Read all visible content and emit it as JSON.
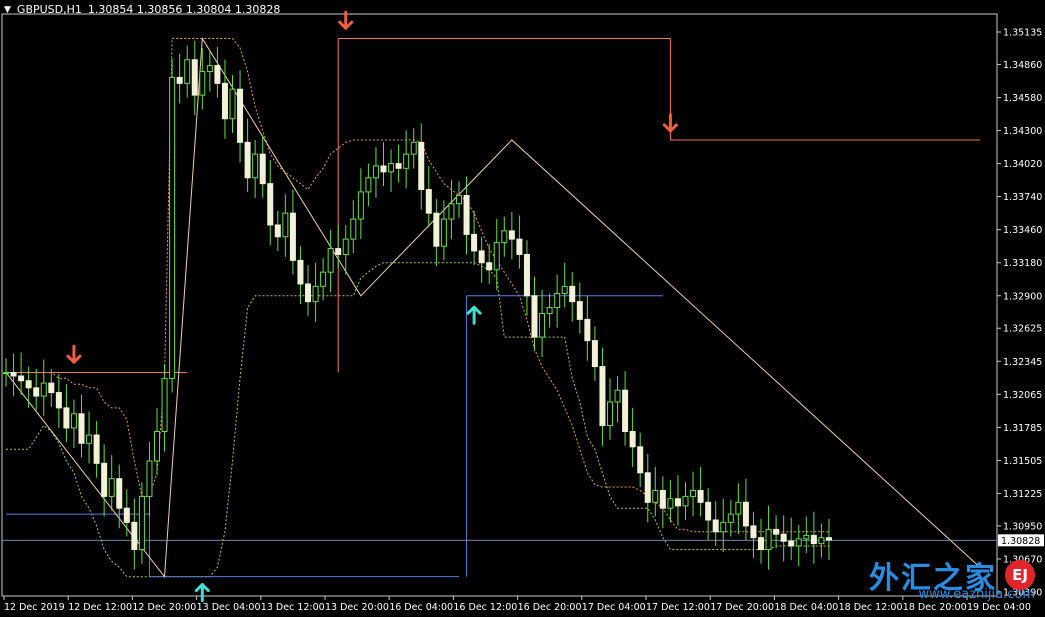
{
  "header": {
    "symbol": "GBPUSD,H1",
    "quote": "1.30854 1.30856 1.30804 1.30828"
  },
  "watermark": {
    "text": "外汇之家",
    "seal": "EJ",
    "url": "www.eazhijia.com"
  },
  "chart_data": {
    "type": "candlestick",
    "price_min": 1.3039,
    "price_max": 1.3518,
    "y_ticks": [
      "1.35135",
      "1.34860",
      "1.34580",
      "1.34300",
      "1.34020",
      "1.33740",
      "1.33460",
      "1.33180",
      "1.32900",
      "1.32625",
      "1.32345",
      "1.32065",
      "1.31785",
      "1.31505",
      "1.31225",
      "1.30950",
      "1.30670",
      "1.30390"
    ],
    "current_price": "1.30828",
    "x_labels": [
      "12 Dec 2019",
      "12 Dec 12:00",
      "12 Dec 20:00",
      "13 Dec 04:00",
      "13 Dec 12:00",
      "13 Dec 20:00",
      "16 Dec 04:00",
      "16 Dec 12:00",
      "16 Dec 20:00",
      "17 Dec 04:00",
      "17 Dec 12:00",
      "17 Dec 20:00",
      "18 Dec 04:00",
      "18 Dec 12:00",
      "18 Dec 20:00",
      "19 Dec 04:00"
    ],
    "closes": [
      1.3225,
      1.3222,
      1.3218,
      1.3212,
      1.3205,
      1.3216,
      1.3208,
      1.3195,
      1.3178,
      1.319,
      1.3165,
      1.3172,
      1.3148,
      1.312,
      1.3135,
      1.311,
      1.3098,
      1.3075,
      1.312,
      1.315,
      1.3175,
      1.322,
      1.3475,
      1.347,
      1.349,
      1.346,
      1.348,
      1.3485,
      1.347,
      1.344,
      1.3465,
      1.342,
      1.339,
      1.341,
      1.3385,
      1.335,
      1.334,
      1.336,
      1.332,
      1.33,
      1.3285,
      1.3298,
      1.331,
      1.333,
      1.3325,
      1.3338,
      1.3355,
      1.3378,
      1.339,
      1.34,
      1.3395,
      1.3402,
      1.3398,
      1.341,
      1.342,
      1.338,
      1.336,
      1.3332,
      1.3355,
      1.3368,
      1.3375,
      1.3342,
      1.3328,
      1.3318,
      1.3312,
      1.3335,
      1.3345,
      1.3338,
      1.3325,
      1.329,
      1.3255,
      1.3275,
      1.328,
      1.3292,
      1.3298,
      1.3285,
      1.327,
      1.3252,
      1.323,
      1.318,
      1.32,
      1.321,
      1.3175,
      1.3162,
      1.314,
      1.3115,
      1.3125,
      1.311,
      1.3118,
      1.3112,
      1.312,
      1.3125,
      1.3115,
      1.31,
      1.309,
      1.3098,
      1.3105,
      1.3115,
      1.3095,
      1.3085,
      1.3075,
      1.3092,
      1.3088,
      1.3082,
      1.3078,
      1.3084,
      1.3087,
      1.308,
      1.3085,
      1.3083
    ],
    "overlays": {
      "upper_channel": [
        1.3225,
        1.3225,
        1.3225,
        1.3225,
        1.3225,
        1.3225,
        1.3225,
        1.322,
        1.322,
        1.3215,
        1.3215,
        1.3212,
        1.3212,
        1.32,
        1.3195,
        1.3195,
        1.3185,
        1.315,
        1.312,
        1.312,
        1.314,
        1.322,
        1.3508,
        1.3508,
        1.3508,
        1.3508,
        1.3508,
        1.3508,
        1.3508,
        1.3508,
        1.3508,
        1.35,
        1.348,
        1.345,
        1.343,
        1.341,
        1.34,
        1.3395,
        1.339,
        1.3385,
        1.338,
        1.339,
        1.3398,
        1.341,
        1.3415,
        1.342,
        1.3422,
        1.3422,
        1.3422,
        1.3422,
        1.3422,
        1.3422,
        1.3422,
        1.3422,
        1.3422,
        1.342,
        1.3405,
        1.3395,
        1.3385,
        1.338,
        1.3375,
        1.337,
        1.336,
        1.3345,
        1.333,
        1.332,
        1.331,
        1.33,
        1.329,
        1.327,
        1.3245,
        1.323,
        1.322,
        1.321,
        1.3195,
        1.318,
        1.316,
        1.314,
        1.313,
        1.3128,
        1.3128,
        1.3128,
        1.3128,
        1.3128,
        1.3125,
        1.312,
        1.3115,
        1.311,
        1.31,
        1.3092,
        1.3092,
        1.309,
        1.309,
        1.309,
        1.309,
        1.309,
        1.309,
        1.309,
        1.309,
        1.309,
        1.309,
        1.309,
        1.309,
        1.309,
        1.309,
        1.309,
        1.309,
        1.309,
        1.309,
        1.309
      ],
      "lower_channel": [
        1.316,
        1.316,
        1.316,
        1.316,
        1.317,
        1.318,
        1.3175,
        1.3165,
        1.315,
        1.314,
        1.312,
        1.311,
        1.3095,
        1.3075,
        1.3065,
        1.306,
        1.3052,
        1.3052,
        1.3052,
        1.3052,
        1.3052,
        1.3052,
        1.3052,
        1.3052,
        1.3052,
        1.3052,
        1.3052,
        1.3052,
        1.306,
        1.309,
        1.315,
        1.322,
        1.328,
        1.329,
        1.329,
        1.329,
        1.329,
        1.329,
        1.329,
        1.329,
        1.329,
        1.329,
        1.329,
        1.329,
        1.329,
        1.329,
        1.329,
        1.3305,
        1.331,
        1.3315,
        1.3318,
        1.3318,
        1.3318,
        1.3318,
        1.3318,
        1.3318,
        1.3318,
        1.3318,
        1.3318,
        1.3318,
        1.3318,
        1.3318,
        1.3318,
        1.3315,
        1.3312,
        1.3305,
        1.3255,
        1.3255,
        1.3255,
        1.3255,
        1.3255,
        1.3255,
        1.3255,
        1.3255,
        1.3255,
        1.322,
        1.32,
        1.317,
        1.316,
        1.314,
        1.312,
        1.311,
        1.311,
        1.311,
        1.311,
        1.311,
        1.31,
        1.3085,
        1.3075,
        1.3075,
        1.3075,
        1.3075,
        1.3075,
        1.3075,
        1.3075,
        1.3075,
        1.3075,
        1.3075,
        1.3075,
        1.3075,
        1.3075,
        1.3075,
        1.3078,
        1.3078,
        1.3078,
        1.3078,
        1.3078,
        1.3078,
        1.3078,
        1.3078
      ],
      "zigzag": [
        [
          0,
          1.3225
        ],
        [
          21,
          1.3052
        ],
        [
          26,
          1.3508
        ],
        [
          47,
          1.329
        ],
        [
          67,
          1.3422
        ],
        [
          129,
          1.306
        ]
      ],
      "resistance_levels": [
        {
          "from": 0,
          "to": 24,
          "price": 1.3225
        },
        {
          "from": 44,
          "to": 88,
          "price": 1.3508
        },
        {
          "from": 88,
          "to": 160,
          "price": 1.3422
        }
      ],
      "support_levels": [
        {
          "from": 0,
          "to": 19,
          "price": 1.3105
        },
        {
          "from": 19,
          "to": 60,
          "price": 1.3052
        },
        {
          "from": 61,
          "to": 87,
          "price": 1.329
        }
      ],
      "sell_arrows": [
        {
          "bar": 9,
          "price": 1.3232
        },
        {
          "bar": 45,
          "price": 1.3515
        },
        {
          "bar": 88,
          "price": 1.3428
        }
      ],
      "buy_arrows": [
        {
          "bar": 26,
          "price": 1.3047
        },
        {
          "bar": 62,
          "price": 1.3282
        }
      ]
    }
  }
}
